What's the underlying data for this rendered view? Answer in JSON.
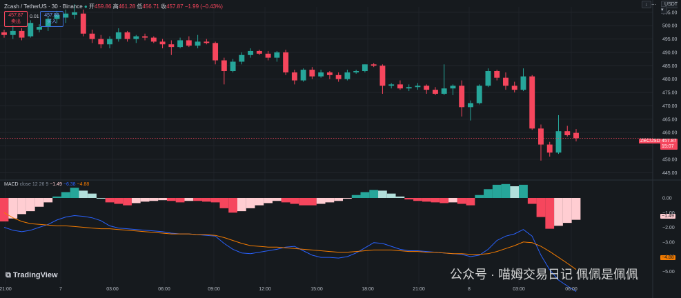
{
  "header": {
    "symbol": "Zcash / TetherUS · 30 · Binance",
    "open_label": "开",
    "open": "459.86",
    "high_label": "高",
    "high": "461.28",
    "low_label": "低",
    "low": "456.71",
    "close_label": "收",
    "close": "457.87",
    "change": "−1.99 (−0.43%)"
  },
  "trade": {
    "sell_price": "457.87",
    "sell_label": "卖出",
    "spread": "0.01",
    "buy_price": "457.88",
    "buy_label": "买入"
  },
  "toolbar": {
    "currency": "USDT ▾",
    "menu_icon": "↓",
    "more": "⋯"
  },
  "price_tag": {
    "symbol": "ZECUSDT",
    "price": "457.87",
    "countdown": "15:07"
  },
  "macd_label": {
    "name": "MACD",
    "params": "close 12 26 9",
    "hist": "−1.49",
    "macd": "−6.38",
    "signal": "−4.88"
  },
  "macd_tags": {
    "hist": "−1.49",
    "signal": "−4.88"
  },
  "branding": {
    "logo": "TradingView",
    "watermark": "公众号 · 喵姆交易日记 佩佩是佩佩"
  },
  "colors": {
    "up": "#26a69a",
    "down": "#f6465d",
    "bg": "#161a1e",
    "macd": "#2962ff",
    "signal": "#f57c00"
  },
  "chart_data": {
    "type": "candlestick",
    "title": "Zcash / TetherUS · 30 · Binance",
    "x_ticks": [
      "21:00",
      "7",
      "03:00",
      "06:00",
      "09:00",
      "12:00",
      "15:00",
      "18:00",
      "21:00",
      "8",
      "03:00",
      "06:00"
    ],
    "ylim": [
      443,
      507
    ],
    "y_ticks": [
      445,
      450,
      455,
      460,
      465,
      470,
      475,
      480,
      485,
      490,
      495,
      500,
      505
    ],
    "candles": [
      [
        497.5,
        498.5,
        495.5,
        496.5
      ],
      [
        496.5,
        500.0,
        495.0,
        498.0
      ],
      [
        498.0,
        499.0,
        494.5,
        495.5
      ],
      [
        496.0,
        502.0,
        495.5,
        501.0
      ],
      [
        498.5,
        500.5,
        497.5,
        499.5
      ],
      [
        499.5,
        503.5,
        498.0,
        502.5
      ],
      [
        502.5,
        505.5,
        501.0,
        504.0
      ],
      [
        503.0,
        506.0,
        501.0,
        504.5
      ],
      [
        504.0,
        508.0,
        502.5,
        505.0
      ],
      [
        504.5,
        506.0,
        496.0,
        497.0
      ],
      [
        497.0,
        498.5,
        493.5,
        495.0
      ],
      [
        495.0,
        496.5,
        491.5,
        493.0
      ],
      [
        493.0,
        496.0,
        491.5,
        495.0
      ],
      [
        495.0,
        499.0,
        494.0,
        497.5
      ],
      [
        497.5,
        498.0,
        494.0,
        495.0
      ],
      [
        495.0,
        496.5,
        493.5,
        496.0
      ],
      [
        496.0,
        497.0,
        494.5,
        495.5
      ],
      [
        495.5,
        496.0,
        493.5,
        494.0
      ],
      [
        494.0,
        495.0,
        491.5,
        493.0
      ],
      [
        493.0,
        494.5,
        489.0,
        492.0
      ],
      [
        492.0,
        495.5,
        491.5,
        494.5
      ],
      [
        494.5,
        496.0,
        492.0,
        492.5
      ],
      [
        492.5,
        496.5,
        491.5,
        494.0
      ],
      [
        494.0,
        495.0,
        493.0,
        493.5
      ],
      [
        493.5,
        494.0,
        485.5,
        487.0
      ],
      [
        487.0,
        488.0,
        478.0,
        483.0
      ],
      [
        483.0,
        487.5,
        482.5,
        486.5
      ],
      [
        486.5,
        490.0,
        485.5,
        489.0
      ],
      [
        489.0,
        491.5,
        488.0,
        490.5
      ],
      [
        490.5,
        491.0,
        489.0,
        489.5
      ],
      [
        489.5,
        490.5,
        487.0,
        488.0
      ],
      [
        488.0,
        490.5,
        486.5,
        490.0
      ],
      [
        490.0,
        491.0,
        481.5,
        482.5
      ],
      [
        482.5,
        483.5,
        478.0,
        479.5
      ],
      [
        479.5,
        484.0,
        479.0,
        483.5
      ],
      [
        483.5,
        484.5,
        480.0,
        481.0
      ],
      [
        481.0,
        483.5,
        480.5,
        482.5
      ],
      [
        482.5,
        483.0,
        480.0,
        481.5
      ],
      [
        481.5,
        482.5,
        479.0,
        480.0
      ],
      [
        480.0,
        483.5,
        479.5,
        482.5
      ],
      [
        482.5,
        483.5,
        482.0,
        483.0
      ],
      [
        483.0,
        485.5,
        482.5,
        485.5
      ],
      [
        485.5,
        486.0,
        484.5,
        485.0
      ],
      [
        485.0,
        485.5,
        474.5,
        477.5
      ],
      [
        477.5,
        478.5,
        476.5,
        478.0
      ],
      [
        478.0,
        479.5,
        476.0,
        476.5
      ],
      [
        476.5,
        478.0,
        475.5,
        477.0
      ],
      [
        477.0,
        478.5,
        476.0,
        477.5
      ],
      [
        477.5,
        478.0,
        474.5,
        476.0
      ],
      [
        476.0,
        477.0,
        474.0,
        474.5
      ],
      [
        474.5,
        485.5,
        474.0,
        476.5
      ],
      [
        476.5,
        478.0,
        474.0,
        477.5
      ],
      [
        477.5,
        479.5,
        466.0,
        469.5
      ],
      [
        469.5,
        472.0,
        464.5,
        471.0
      ],
      [
        471.0,
        478.0,
        470.5,
        477.5
      ],
      [
        477.5,
        484.0,
        477.0,
        483.0
      ],
      [
        483.0,
        483.5,
        479.5,
        480.5
      ],
      [
        480.5,
        482.5,
        476.0,
        477.5
      ],
      [
        477.5,
        479.0,
        475.0,
        476.0
      ],
      [
        476.0,
        484.0,
        475.5,
        481.0
      ],
      [
        481.0,
        481.5,
        461.0,
        461.5
      ],
      [
        461.5,
        463.0,
        449.5,
        455.5
      ],
      [
        455.5,
        456.5,
        451.0,
        452.5
      ],
      [
        452.5,
        466.5,
        452.0,
        460.5
      ],
      [
        460.5,
        462.5,
        458.5,
        459.0
      ],
      [
        459.86,
        461.28,
        456.71,
        457.87
      ]
    ],
    "macd_pane": {
      "ylim": [
        -5.6,
        0.8
      ],
      "y_ticks": [
        0.0,
        -1.0,
        -2.0,
        -3.0,
        -4.0,
        -5.0
      ],
      "histogram": [
        -1.6,
        -1.4,
        -1.1,
        -0.9,
        -0.6,
        -0.3,
        0.1,
        0.4,
        0.7,
        0.5,
        0.3,
        0.0,
        -0.3,
        -0.4,
        -0.5,
        -0.35,
        -0.25,
        -0.2,
        -0.15,
        -0.2,
        -0.3,
        -0.2,
        -0.2,
        -0.25,
        -0.3,
        -0.7,
        -1.0,
        -0.9,
        -0.7,
        -0.5,
        -0.35,
        -0.2,
        -0.3,
        -0.4,
        -0.5,
        -0.5,
        -0.4,
        -0.3,
        -0.2,
        -0.05,
        0.2,
        0.4,
        0.55,
        0.5,
        0.3,
        0.1,
        -0.1,
        -0.2,
        -0.25,
        -0.3,
        -0.35,
        -0.3,
        -0.4,
        -0.5,
        0.2,
        0.6,
        0.9,
        0.95,
        0.8,
        0.9,
        -0.4,
        -1.3,
        -2.1,
        -1.9,
        -1.7,
        -1.49
      ],
      "macd": [
        -2.0,
        -2.2,
        -2.3,
        -2.2,
        -2.0,
        -1.8,
        -1.5,
        -1.3,
        -1.2,
        -1.25,
        -1.35,
        -1.55,
        -1.9,
        -2.05,
        -2.1,
        -2.15,
        -2.2,
        -2.25,
        -2.3,
        -2.4,
        -2.45,
        -2.45,
        -2.5,
        -2.55,
        -2.6,
        -3.1,
        -3.5,
        -3.75,
        -3.8,
        -3.7,
        -3.6,
        -3.5,
        -3.35,
        -3.3,
        -3.6,
        -3.9,
        -4.05,
        -4.05,
        -4.1,
        -4.0,
        -3.75,
        -3.4,
        -3.05,
        -3.1,
        -3.3,
        -3.5,
        -3.6,
        -3.6,
        -3.65,
        -3.7,
        -3.75,
        -3.8,
        -3.85,
        -4.0,
        -3.9,
        -3.5,
        -2.9,
        -2.6,
        -2.45,
        -2.15,
        -2.6,
        -3.9,
        -4.9,
        -5.6,
        -6.0,
        -6.38
      ],
      "signal": [
        -1.0,
        -1.35,
        -1.6,
        -1.75,
        -1.8,
        -1.85,
        -1.9,
        -1.9,
        -1.95,
        -2.0,
        -2.05,
        -2.1,
        -2.1,
        -2.15,
        -2.2,
        -2.25,
        -2.3,
        -2.35,
        -2.4,
        -2.45,
        -2.45,
        -2.45,
        -2.5,
        -2.5,
        -2.55,
        -2.7,
        -2.9,
        -3.1,
        -3.25,
        -3.3,
        -3.35,
        -3.35,
        -3.4,
        -3.45,
        -3.5,
        -3.55,
        -3.6,
        -3.65,
        -3.7,
        -3.7,
        -3.65,
        -3.6,
        -3.55,
        -3.55,
        -3.55,
        -3.6,
        -3.65,
        -3.65,
        -3.7,
        -3.7,
        -3.75,
        -3.8,
        -3.8,
        -3.85,
        -3.85,
        -3.8,
        -3.65,
        -3.45,
        -3.25,
        -3.0,
        -3.05,
        -3.3,
        -3.65,
        -4.05,
        -4.45,
        -4.88
      ]
    }
  }
}
